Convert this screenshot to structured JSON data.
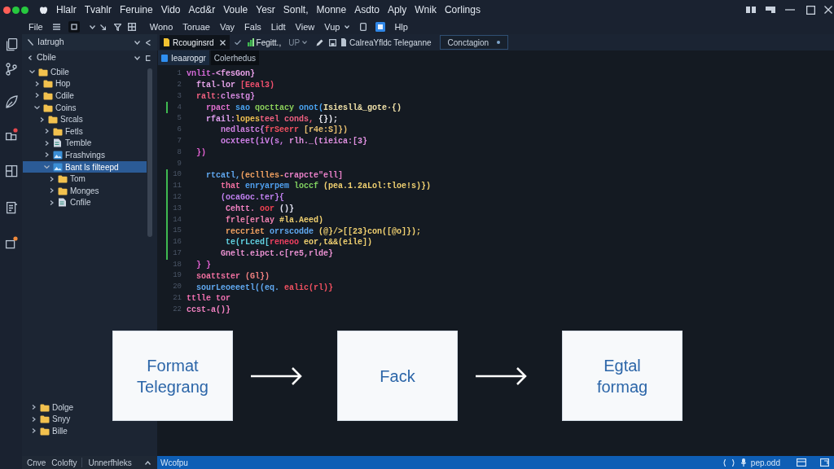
{
  "menu_bar": [
    "Hlalr",
    "Tvahlr",
    "Feruine",
    "Vido",
    "Acd&r",
    "Voule",
    "Yesr",
    "Sonlt,",
    "Monne",
    "Asdto",
    "Aply",
    "Wnik",
    "Corlings"
  ],
  "toolbar": {
    "file": "File",
    "menu": [
      "Wono",
      "Toruae",
      "Vay",
      "Fals",
      "Lidt",
      "View"
    ],
    "dropdown": "Vup",
    "help": "Hlp"
  },
  "sidebar": {
    "title": "Iatrugh",
    "section": "Cbile",
    "tree": [
      {
        "label": "Cbile",
        "kind": "folder",
        "expanded": true,
        "selected": false,
        "children": [
          {
            "label": "Hop",
            "kind": "folder",
            "expanded": false,
            "selected": false
          },
          {
            "label": "Cdile",
            "kind": "folder",
            "expanded": false,
            "selected": false
          },
          {
            "label": "Coins",
            "kind": "folder",
            "expanded": true,
            "selected": false,
            "children": [
              {
                "label": "Srcals",
                "kind": "folder",
                "expanded": false,
                "selected": false,
                "children": [
                  {
                    "label": "Fetls",
                    "kind": "folder",
                    "expanded": false,
                    "selected": false
                  },
                  {
                    "label": "Temble",
                    "kind": "file",
                    "expanded": false,
                    "selected": false
                  },
                  {
                    "label": "Frashvings",
                    "kind": "image",
                    "expanded": false,
                    "selected": false
                  },
                  {
                    "label": "Bant ls filteepd",
                    "kind": "image",
                    "expanded": true,
                    "selected": true,
                    "children": [
                      {
                        "label": "Tom",
                        "kind": "folder",
                        "expanded": false,
                        "selected": false
                      },
                      {
                        "label": "Monges",
                        "kind": "folder",
                        "expanded": false,
                        "selected": false
                      },
                      {
                        "label": "Cnfile",
                        "kind": "file",
                        "expanded": false,
                        "selected": false
                      }
                    ]
                  }
                ]
              }
            ]
          }
        ]
      }
    ],
    "tree_bottom": [
      {
        "label": "Dolge",
        "kind": "folder",
        "expanded": false,
        "selected": false
      },
      {
        "label": "Snyy",
        "kind": "folder",
        "expanded": false,
        "selected": false
      },
      {
        "label": "Bille",
        "kind": "folder",
        "expanded": false,
        "selected": false
      }
    ],
    "panel_tabs": [
      "Cnve",
      "Colofty",
      "Unnerfhleks"
    ]
  },
  "tab_strip": [
    {
      "kind": "file_tab",
      "label": "Rcouginsrd",
      "selected": true,
      "modified": false
    },
    {
      "kind": "branch",
      "label": "Fegitt.,",
      "extra": "UP"
    },
    {
      "kind": "path",
      "label": "CalreaYfldc Teleganne"
    },
    {
      "kind": "tab",
      "label": "Conctagion",
      "selected": false,
      "modified": true
    }
  ],
  "sub_tabs": [
    {
      "label": "Ieaaropgr",
      "selected": true
    },
    {
      "label": "Colerhedus",
      "selected": false
    }
  ],
  "code": {
    "lines": [
      {
        "number": "1",
        "changed": false,
        "tokens": [
          {
            "text": "vnlit-",
            "color": "#d46ad8"
          },
          {
            "text": "<fesGon}",
            "color": "#e8a0e8"
          }
        ],
        "children": [
          {
            "number": "2",
            "changed": false,
            "tokens": [
              {
                "text": "ftal-lor ",
                "color": "#e4a3e8"
              },
              {
                "text": "[Eeal3)",
                "color": "#f0506e"
              }
            ]
          },
          {
            "number": "3",
            "changed": false,
            "tokens": [
              {
                "text": "ralt:",
                "color": "#f06080"
              },
              {
                "text": "clestg}",
                "color": "#d68ae0"
              }
            ],
            "children": [
              {
                "number": "4",
                "changed": true,
                "tokens": [
                  {
                    "text": "rpact",
                    "color": "#e070d0"
                  },
                  {
                    "text": " sao",
                    "color": "#4aa3f0"
                  },
                  {
                    "text": " qocttacy",
                    "color": "#8bd05a"
                  },
                  {
                    "text": " onot(",
                    "color": "#4aa3f0"
                  },
                  {
                    "text": "Isiesll&_gote·{)",
                    "color": "#efe0a8"
                  }
                ]
              },
              {
                "number": "5",
                "changed": false,
                "tokens": [
                  {
                    "text": "rfail:",
                    "color": "#e0a0f0"
                  },
                  {
                    "text": "lopes",
                    "color": "#f0c050"
                  },
                  {
                    "text": "teel conds,",
                    "color": "#f06080"
                  },
                  {
                    "text": " {});",
                    "color": "#e8e8f0"
                  }
                ],
                "children": [
                  {
                    "number": "6",
                    "changed": false,
                    "tokens": [
                      {
                        "text": "nedlastc{",
                        "color": "#d080e0"
                      },
                      {
                        "text": "frSeerr",
                        "color": "#f05060"
                      },
                      {
                        "text": " [r4e:S]})",
                        "color": "#e8c070"
                      }
                    ]
                  },
                  {
                    "number": "7",
                    "changed": false,
                    "tokens": [
                      {
                        "text": "ocxteet(iV(s,",
                        "color": "#d080e8"
                      },
                      {
                        "text": " rlh._(tieica:[3}",
                        "color": "#e090e0"
                      }
                    ]
                  }
                ]
              }
            ]
          },
          {
            "number": "8",
            "changed": false,
            "tokens": [
              {
                "text": "})",
                "color": "#e060d0"
              }
            ],
            "children": [
              {
                "number": "9",
                "changed": false
              },
              {
                "number": "10",
                "changed": true,
                "tokens": [
                  {
                    "text": "rtcatl,",
                    "color": "#60a8f0"
                  },
                  {
                    "text": "(ecllles-",
                    "color": "#f0a060"
                  },
                  {
                    "text": "crapcte\"ell]",
                    "color": "#e880c8"
                  }
                ],
                "children": [
                  {
                    "number": "11",
                    "changed": true,
                    "tokens": [
                      {
                        "text": "that",
                        "color": "#f070a0"
                      },
                      {
                        "text": " enryarpem",
                        "color": "#50a0f0"
                      },
                      {
                        "text": " loccf",
                        "color": "#80d060"
                      },
                      {
                        "text": " (pea.1.2aLol:tloe!s)})",
                        "color": "#f0d070"
                      }
                    ]
                  },
                  {
                    "number": "12",
                    "changed": true,
                    "tokens": [
                      {
                        "text": "(ocaGoc.ter}{",
                        "color": "#c080f0"
                      }
                    ],
                    "children": [
                      {
                        "number": "13",
                        "changed": true,
                        "tokens": [
                          {
                            "text": "Cehtt.",
                            "color": "#f080c0"
                          },
                          {
                            "text": " oor",
                            "color": "#f04050"
                          },
                          {
                            "text": " ()}",
                            "color": "#e0e0f0"
                          }
                        ]
                      },
                      {
                        "number": "14",
                        "changed": true,
                        "tokens": [
                          {
                            "text": "frle[erlay",
                            "color": "#f080b0"
                          },
                          {
                            "text": " #la.Aeed)",
                            "color": "#f0d070"
                          }
                        ]
                      },
                      {
                        "number": "15",
                        "changed": true,
                        "tokens": [
                          {
                            "text": "reccriet",
                            "color": "#f0a060"
                          },
                          {
                            "text": " orrscodde",
                            "color": "#60a8f0"
                          },
                          {
                            "text": " (@}/>[[23}con([@o]});",
                            "color": "#f0d070"
                          }
                        ]
                      },
                      {
                        "number": "16",
                        "changed": true,
                        "tokens": [
                          {
                            "text": "te(rLced[",
                            "color": "#60d0e0"
                          },
                          {
                            "text": "reneoo",
                            "color": "#f04060"
                          },
                          {
                            "text": " eor,t&&(eile])",
                            "color": "#f0d070"
                          }
                        ]
                      }
                    ]
                  },
                  {
                    "number": "17",
                    "changed": true,
                    "tokens": [
                      {
                        "text": "Gnelt.eipct.c[re5,rlde}",
                        "color": "#e890d0"
                      }
                    ]
                  }
                ]
              }
            ]
          },
          {
            "number": "18",
            "changed": false,
            "tokens": [
              {
                "text": "} }",
                "color": "#e060d0"
              }
            ]
          },
          {
            "number": "19",
            "changed": false,
            "tokens": [
              {
                "text": "soattster",
                "color": "#f070a0"
              },
              {
                "text": " (Gl})",
                "color": "#f08080"
              }
            ]
          },
          {
            "number": "20",
            "changed": false,
            "tokens": [
              {
                "text": "sourLeoeeetl((eq.",
                "color": "#60a8f0"
              },
              {
                "text": " ealic(rl)}",
                "color": "#f05060"
              }
            ]
          }
        ]
      },
      {
        "number": "21",
        "changed": false,
        "tokens": [
          {
            "text": "ttlle tor",
            "color": "#f070b0"
          }
        ]
      },
      {
        "number": "22",
        "changed": false,
        "tokens": [
          {
            "text": "ccst-a()}",
            "color": "#f080c0"
          }
        ]
      }
    ]
  },
  "diagram": {
    "nodes": [
      "Format Telegrang",
      "Fack",
      "Egtal formag"
    ]
  },
  "status_bar": {
    "left": "Wcofpu",
    "right": "pep.odd"
  }
}
